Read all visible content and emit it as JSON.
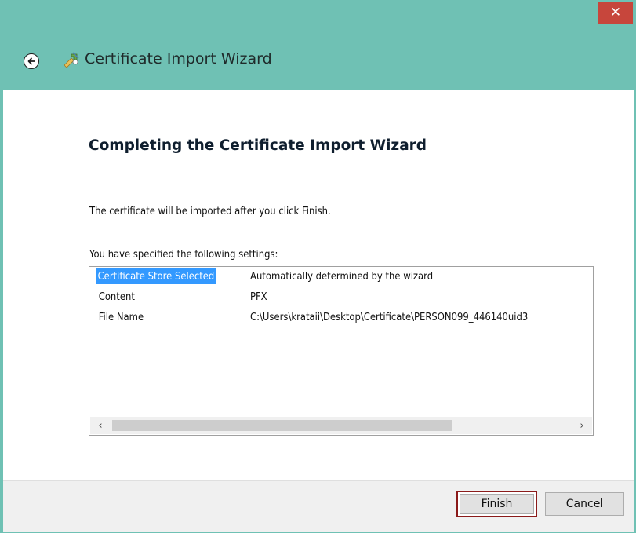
{
  "window": {
    "close_label": "✕",
    "accent_color": "#6fc1b4",
    "close_color": "#c7463c"
  },
  "nav": {
    "back_icon": "back-arrow-icon",
    "wizard_icon": "certificate-icon",
    "title": "Certificate Import Wizard"
  },
  "main": {
    "heading": "Completing the Certificate Import Wizard",
    "description": "The certificate will be imported after you click Finish.",
    "settings_label": "You have specified the following settings:",
    "settings": [
      {
        "name": "Certificate Store Selected",
        "value": "Automatically determined by the wizard",
        "selected": true
      },
      {
        "name": "Content",
        "value": "PFX",
        "selected": false
      },
      {
        "name": "File Name",
        "value": "C:\\Users\\krataii\\Desktop\\Certificate\\PERSON099_446140uid3",
        "selected": false
      }
    ],
    "scroll_left": "‹",
    "scroll_right": "›"
  },
  "footer": {
    "finish_label": "Finish",
    "cancel_label": "Cancel",
    "highlight_color": "#8b1a1a"
  }
}
